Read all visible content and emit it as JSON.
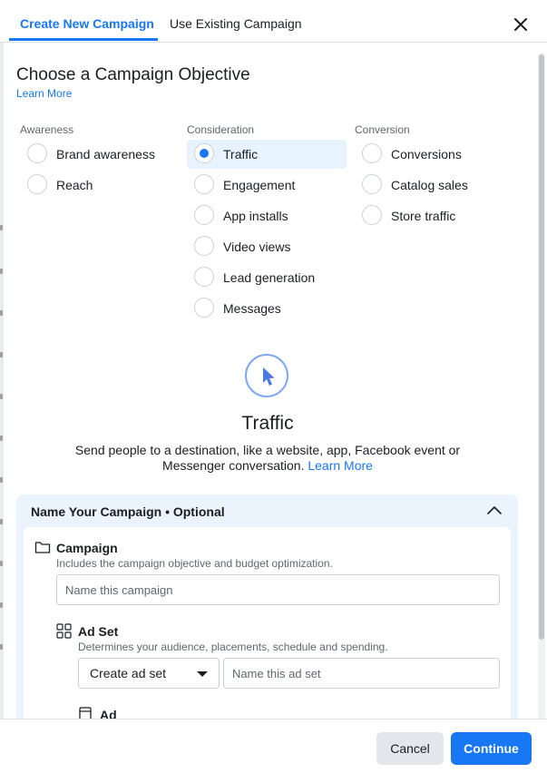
{
  "tabs": [
    {
      "label": "Create New Campaign",
      "active": true
    },
    {
      "label": "Use Existing Campaign",
      "active": false
    }
  ],
  "close_icon": "close-icon",
  "heading": "Choose a Campaign Objective",
  "learn_more": "Learn More",
  "columns": [
    {
      "title": "Awareness",
      "options": [
        "Brand awareness",
        "Reach"
      ]
    },
    {
      "title": "Consideration",
      "options": [
        "Traffic",
        "Engagement",
        "App installs",
        "Video views",
        "Lead generation",
        "Messages"
      ]
    },
    {
      "title": "Conversion",
      "options": [
        "Conversions",
        "Catalog sales",
        "Store traffic"
      ]
    }
  ],
  "selected_objective": "Traffic",
  "objective": {
    "icon": "cursor-icon",
    "title": "Traffic",
    "description": "Send people to a destination, like a website, app, Facebook event or Messenger conversation.",
    "learn_more": "Learn More"
  },
  "name_section": {
    "header": "Name Your Campaign • Optional",
    "campaign": {
      "icon": "folder-icon",
      "title": "Campaign",
      "description": "Includes the campaign objective and budget optimization.",
      "placeholder": "Name this campaign"
    },
    "ad_set": {
      "icon": "grid-icon",
      "title": "Ad Set",
      "description": "Determines your audience, placements, schedule and spending.",
      "select_value": "Create ad set",
      "placeholder": "Name this ad set"
    },
    "ad": {
      "icon": "ad-icon",
      "title": "Ad"
    }
  },
  "footer": {
    "cancel": "Cancel",
    "continue": "Continue"
  },
  "colors": {
    "accent": "#1877f2",
    "selected_bg": "#e7f3ff",
    "section_bg": "#ebf3fd"
  }
}
